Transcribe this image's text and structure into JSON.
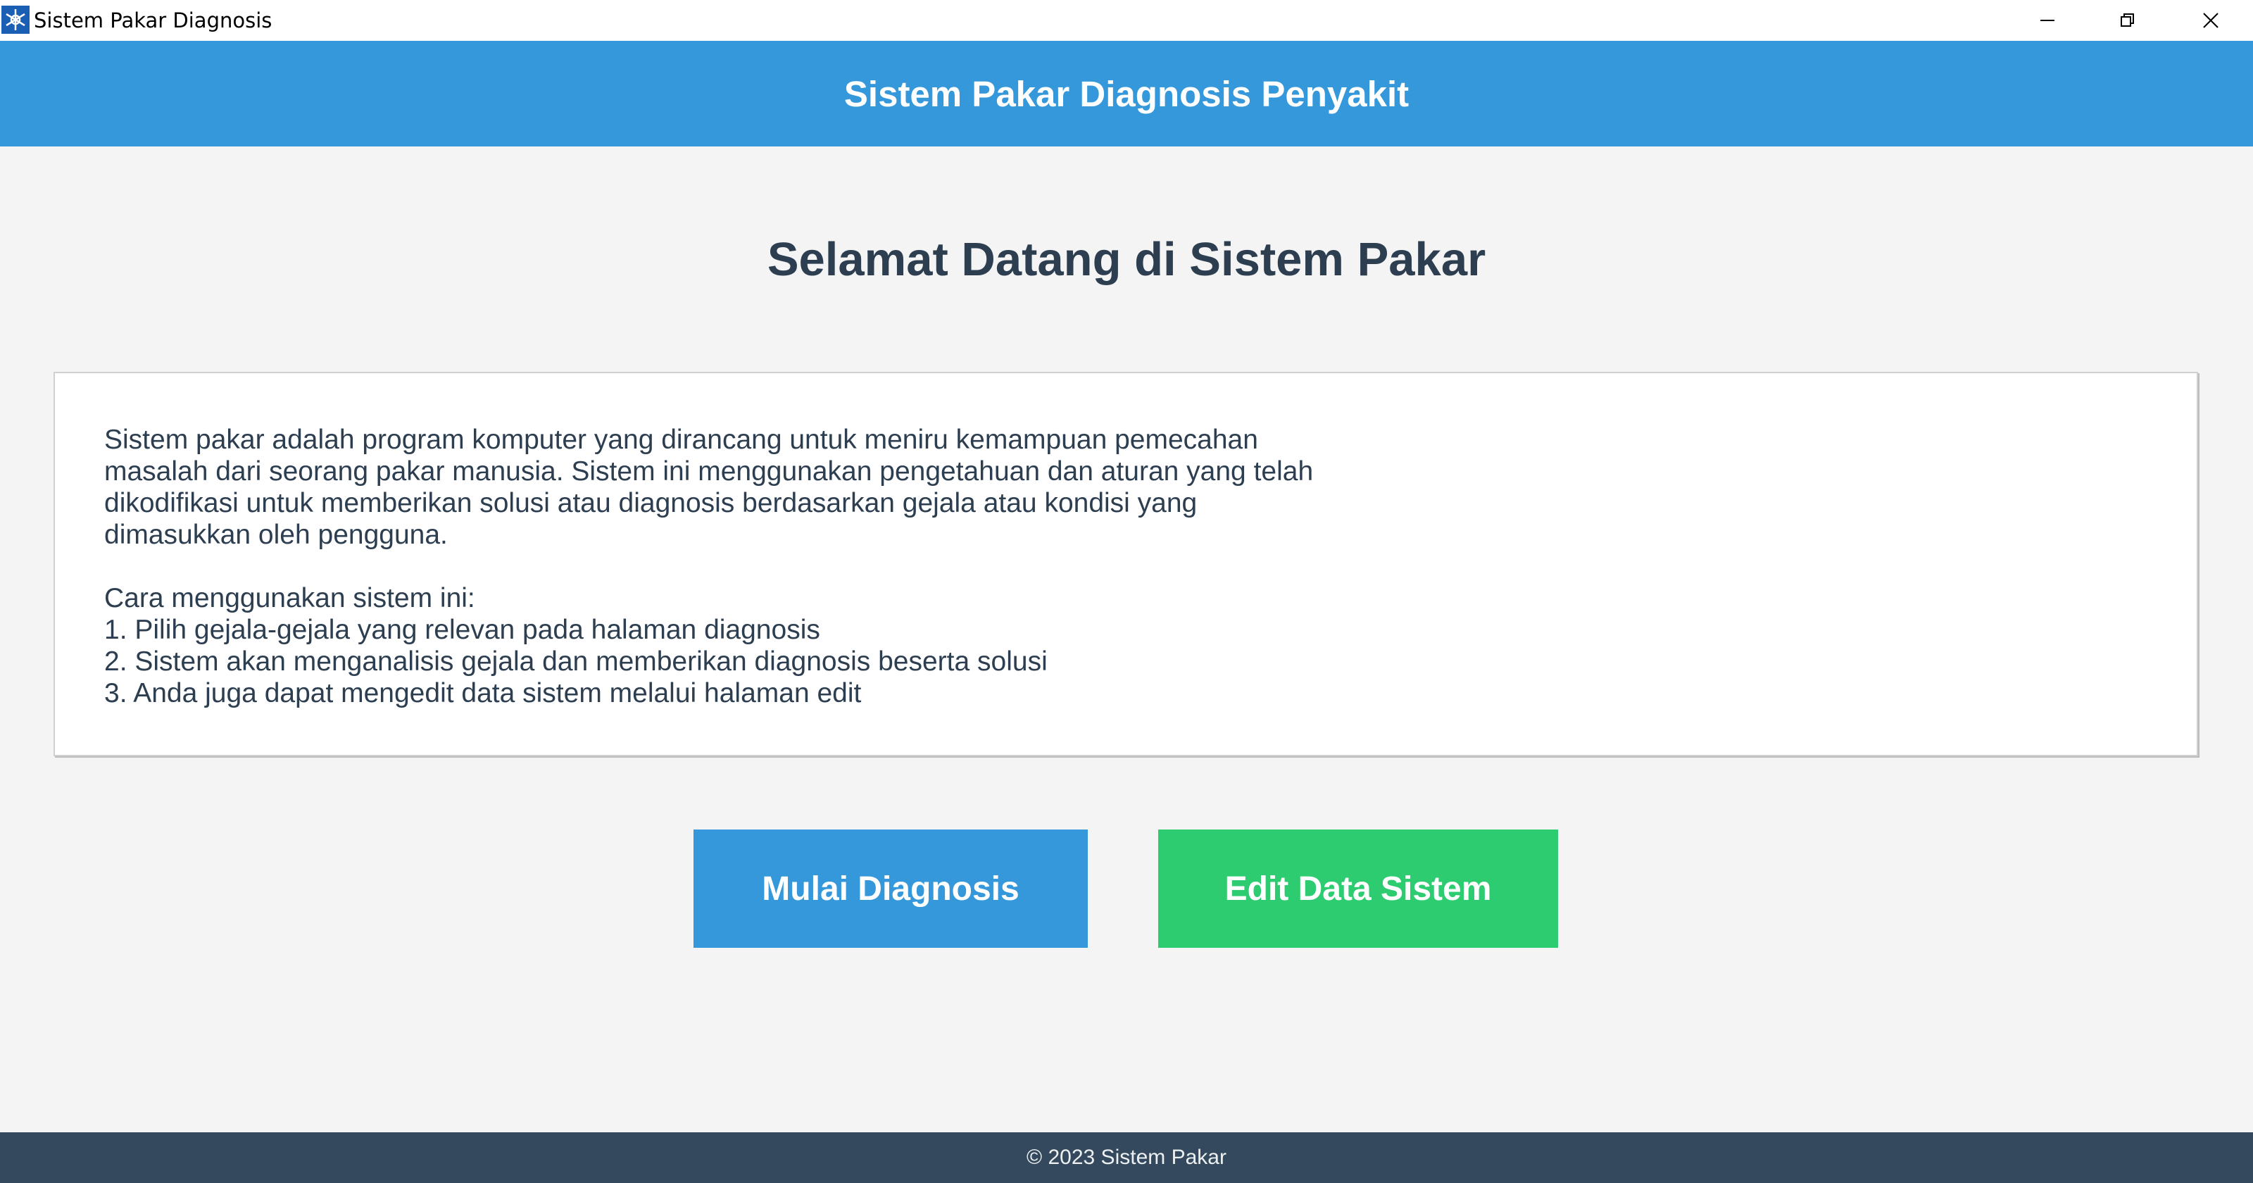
{
  "window": {
    "title": "Sistem Pakar Diagnosis",
    "icon": "app-icon"
  },
  "header": {
    "title": "Sistem Pakar Diagnosis Penyakit"
  },
  "main": {
    "welcome": "Selamat Datang di Sistem Pakar",
    "description_lines": [
      "Sistem pakar adalah program komputer yang dirancang untuk meniru kemampuan pemecahan",
      "masalah dari seorang pakar manusia. Sistem ini menggunakan pengetahuan dan aturan yang telah",
      "dikodifikasi untuk memberikan solusi atau diagnosis berdasarkan gejala atau kondisi yang",
      "dimasukkan oleh pengguna."
    ],
    "howto_title": "Cara menggunakan sistem ini:",
    "steps": [
      "1. Pilih gejala-gejala yang relevan pada halaman diagnosis",
      "2. Sistem akan menganalisis gejala dan memberikan diagnosis beserta solusi",
      "3. Anda juga dapat mengedit data sistem melalui halaman edit"
    ]
  },
  "buttons": {
    "diagnose": "Mulai Diagnosis",
    "edit": "Edit Data Sistem"
  },
  "footer": {
    "text": "© 2023 Sistem Pakar"
  },
  "colors": {
    "header": "#3498db",
    "diagnose_button": "#3498db",
    "edit_button": "#2ecc71",
    "footer": "#34495e",
    "heading_text": "#2c3e50",
    "background": "#f4f4f4"
  }
}
